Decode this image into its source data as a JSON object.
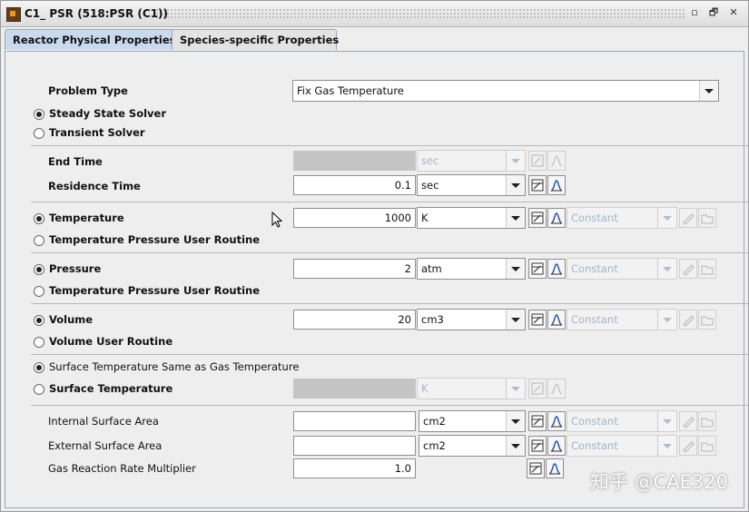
{
  "window": {
    "title": "C1_ PSR  (518:PSR (C1))",
    "minimize_glyph": "▫",
    "restore_glyph": "🗗",
    "close_glyph": "✕"
  },
  "tabs": [
    {
      "label": "Reactor Physical Properties",
      "active": true
    },
    {
      "label": "Species-specific Properties",
      "active": false
    }
  ],
  "problem_type": {
    "label": "Problem Type",
    "value": "Fix Gas Temperature"
  },
  "solver": [
    {
      "label": "Steady State Solver",
      "selected": true
    },
    {
      "label": "Transient Solver",
      "selected": false
    }
  ],
  "end_time": {
    "label": "End Time",
    "value": "",
    "unit": "sec",
    "enabled": false
  },
  "residence_time": {
    "label": "Residence Time",
    "value": "0.1",
    "unit": "sec"
  },
  "temperature": {
    "options": [
      {
        "label": "Temperature",
        "selected": true
      },
      {
        "label": "Temperature Pressure User Routine",
        "selected": false
      }
    ],
    "value": "1000",
    "unit": "K",
    "profile": "Constant"
  },
  "pressure": {
    "options": [
      {
        "label": "Pressure",
        "selected": true
      },
      {
        "label": "Temperature Pressure User Routine",
        "selected": false
      }
    ],
    "value": "2",
    "unit": "atm",
    "profile": "Constant"
  },
  "volume": {
    "options": [
      {
        "label": "Volume",
        "selected": true
      },
      {
        "label": "Volume User Routine",
        "selected": false
      }
    ],
    "value": "20",
    "unit": "cm3",
    "profile": "Constant"
  },
  "surface_temperature": {
    "options": [
      {
        "label": "Surface Temperature Same as Gas Temperature",
        "selected": true
      },
      {
        "label": "Surface Temperature",
        "selected": false
      }
    ],
    "value": "",
    "unit": "K",
    "enabled": false
  },
  "internal_surface_area": {
    "label": "Internal Surface Area",
    "value": "",
    "unit": "cm2",
    "profile": "Constant"
  },
  "external_surface_area": {
    "label": "External Surface Area",
    "value": "",
    "unit": "cm2",
    "profile": "Constant"
  },
  "gas_reaction_rate_multiplier": {
    "label": "Gas Reaction Rate Multiplier",
    "value": "1.0"
  },
  "watermark": "知乎 @CAE320",
  "icons": [
    "app-icon",
    "edit-table-icon",
    "profile-curve-icon",
    "pencil-icon",
    "folder-icon",
    "mouse-cursor-icon"
  ]
}
